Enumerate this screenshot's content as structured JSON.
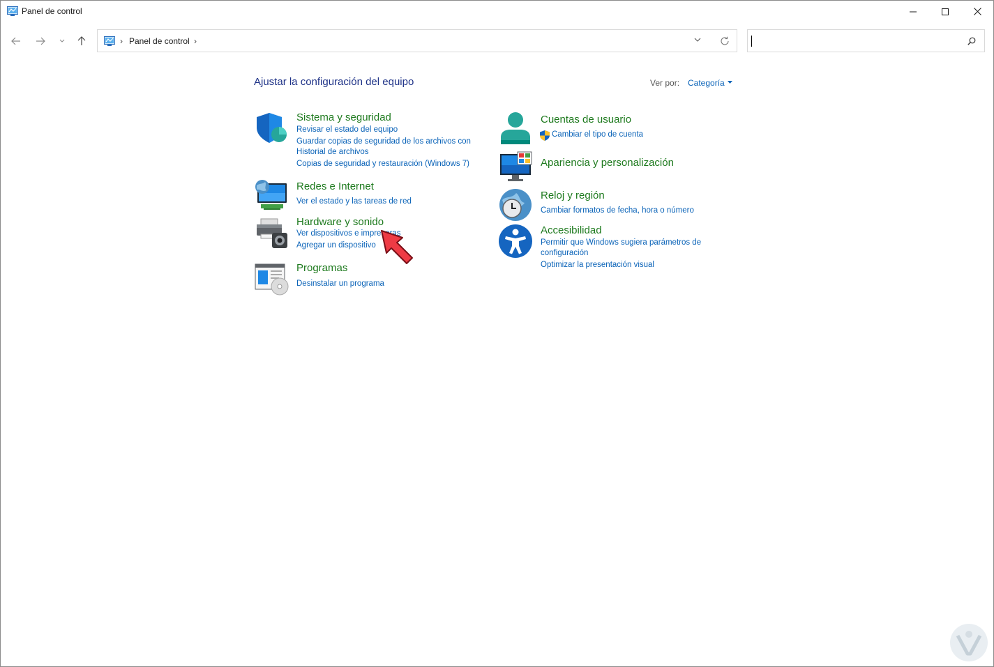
{
  "window": {
    "title": "Panel de control",
    "minimize_icon": "minimize-icon",
    "maximize_icon": "maximize-icon",
    "close_icon": "close-icon"
  },
  "address": {
    "path": "Panel de control",
    "separator": "›",
    "search_placeholder": ""
  },
  "header": {
    "title": "Ajustar la configuración del equipo",
    "view_by_label": "Ver por:",
    "view_by_value": "Categoría"
  },
  "categories": {
    "system": {
      "title": "Sistema y seguridad",
      "links": [
        "Revisar el estado del equipo",
        "Guardar copias de seguridad de los archivos con",
        "Historial de archivos",
        "Copias de seguridad y restauración (Windows 7)"
      ]
    },
    "network": {
      "title": "Redes e Internet",
      "links": [
        "Ver el estado y las tareas de red"
      ]
    },
    "hardware": {
      "title": "Hardware y sonido",
      "links": [
        "Ver dispositivos e impresoras",
        "Agregar un dispositivo"
      ]
    },
    "programs": {
      "title": "Programas",
      "links": [
        "Desinstalar un programa"
      ]
    },
    "accounts": {
      "title": "Cuentas de usuario",
      "links": [
        "Cambiar el tipo de cuenta"
      ]
    },
    "appearance": {
      "title": "Apariencia y personalización",
      "links": []
    },
    "clock": {
      "title": "Reloj y región",
      "links": [
        "Cambiar formatos de fecha, hora o número"
      ]
    },
    "accessibility": {
      "title": "Accesibilidad",
      "links": [
        "Permitir que Windows sugiera parámetros de",
        "configuración",
        "Optimizar la presentación visual"
      ]
    }
  },
  "colors": {
    "heading": "#1e3287",
    "category_title": "#1e7a1e",
    "link": "#0a63b8"
  }
}
